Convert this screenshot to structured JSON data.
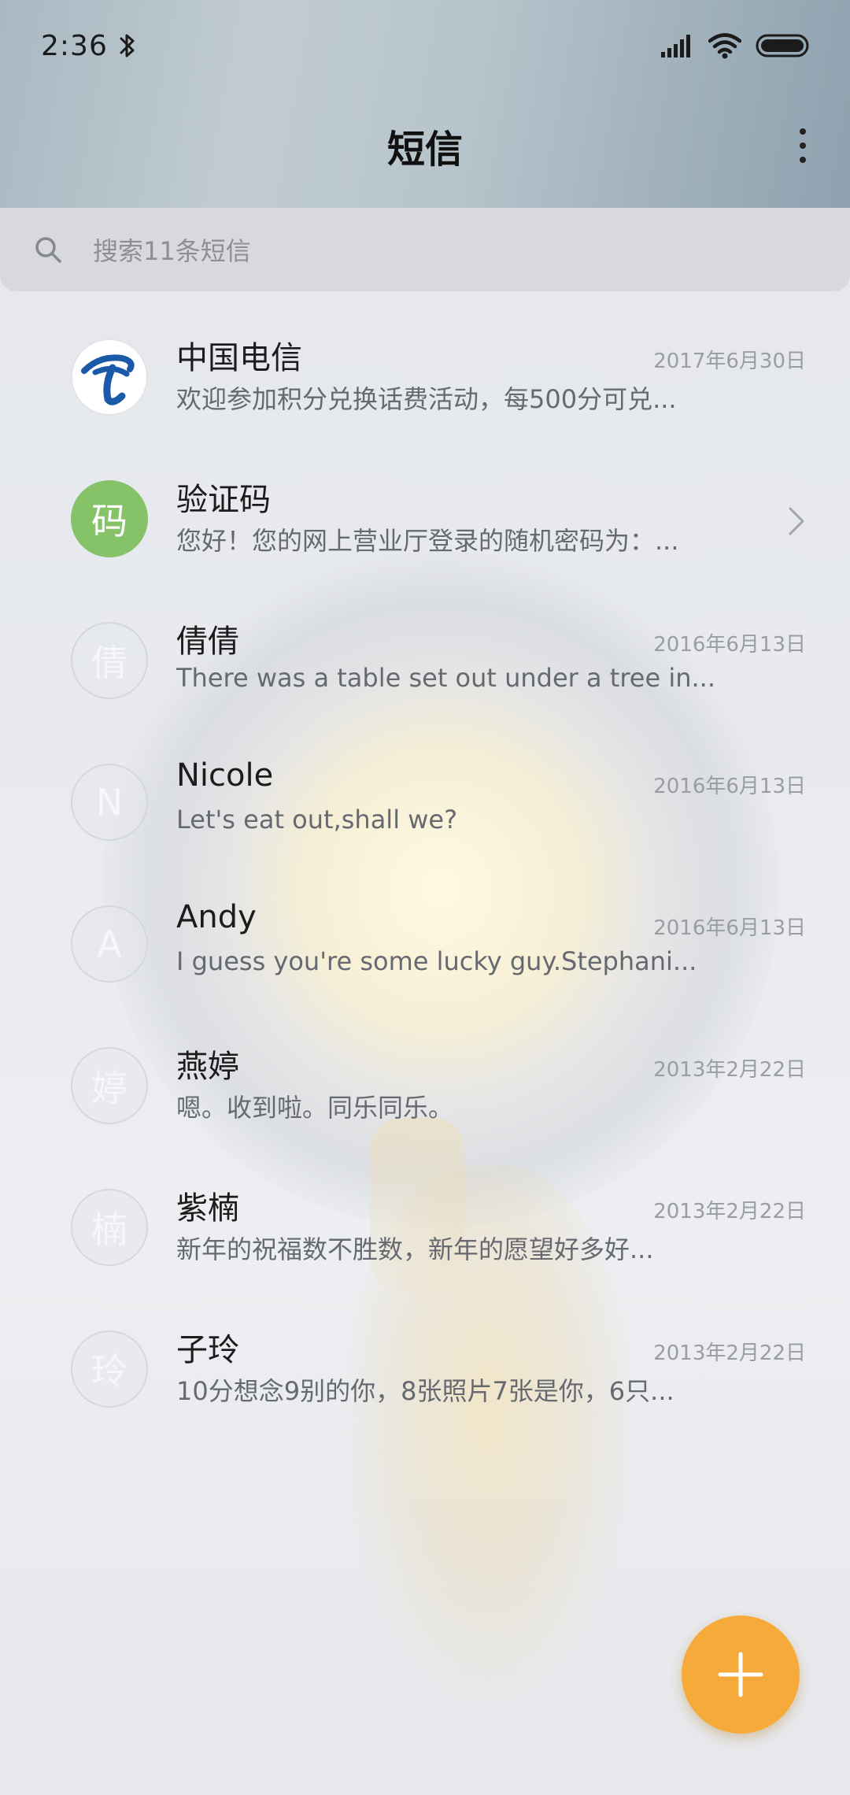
{
  "status_bar": {
    "time": "2:36",
    "icons": [
      "bluetooth-icon",
      "signal-icon",
      "wifi-icon",
      "battery-icon"
    ]
  },
  "header": {
    "title": "短信",
    "more_icon": "more-vertical-icon"
  },
  "search": {
    "placeholder": "搜索11条短信",
    "icon": "search-icon"
  },
  "conversations": [
    {
      "name": "中国电信",
      "preview": "欢迎参加积分兑换话费活动，每500分可兑...",
      "date": "2017年6月30日",
      "avatar": "telecom-logo-icon",
      "avatar_text": ""
    },
    {
      "name": "验证码",
      "preview": "您好！您的网上营业厅登录的随机密码为：...",
      "date": "",
      "avatar_text": "码",
      "has_chevron": true
    },
    {
      "name": "倩倩",
      "preview": "There was a table set out under a tree in...",
      "date": "2016年6月13日",
      "avatar_text": "倩"
    },
    {
      "name": "Nicole",
      "preview": "Let's eat out,shall we?",
      "date": "2016年6月13日",
      "avatar_text": "N"
    },
    {
      "name": "Andy",
      "preview": "I guess you're some lucky guy.Stephani...",
      "date": "2016年6月13日",
      "avatar_text": "A"
    },
    {
      "name": "燕婷",
      "preview": "嗯。收到啦。同乐同乐。",
      "date": "2013年2月22日",
      "avatar_text": "婷"
    },
    {
      "name": "紫楠",
      "preview": "新年的祝福数不胜数，新年的愿望好多好...",
      "date": "2013年2月22日",
      "avatar_text": "楠"
    },
    {
      "name": "子玲",
      "preview": "10分想念9别的你，8张照片7张是你，6只...",
      "date": "2013年2月22日",
      "avatar_text": "玲"
    }
  ],
  "fab": {
    "icon": "plus-icon"
  },
  "colors": {
    "accent": "#f5aa3a",
    "avatar_green": "#86c267",
    "telecom_blue": "#1a5aa8"
  }
}
